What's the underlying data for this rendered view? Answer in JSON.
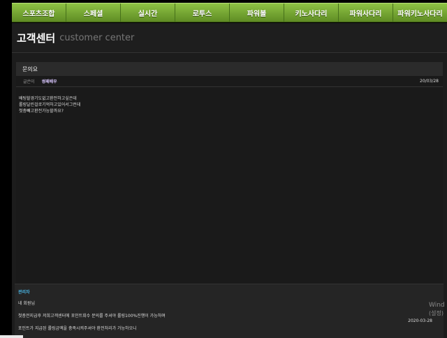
{
  "nav": {
    "items": [
      {
        "label": "스포츠조합"
      },
      {
        "label": "스페셜"
      },
      {
        "label": "실시간"
      },
      {
        "label": "로투스"
      },
      {
        "label": "파워볼"
      },
      {
        "label": "키노사다리"
      },
      {
        "label": "파워사다리"
      },
      {
        "label": "파워키노사다리"
      }
    ]
  },
  "header": {
    "title": "고객센터",
    "subtitle": "customer center"
  },
  "post": {
    "title": "문의요",
    "author_label": "글쓴이",
    "author": "썽패배우",
    "date": "20/03/28",
    "body_lines": [
      "배팅할경기도없고환전하고싶은데",
      "롤링달린걸로기억하고있어서그런데",
      "첫충빼고환전가능할까요?"
    ]
  },
  "reply": {
    "label": "관리자",
    "lines": [
      "네 회원님",
      "첫충전지급후 저희고객센터에 포인트회수 문의를 주셔야 롤링100%진행이 가능하며",
      "포인트가 지급된 롤링금액을 충족시켜주셔야 환전처리가 가능하오니"
    ],
    "date": "2020-03-28"
  },
  "watermark": {
    "line1": "Wind",
    "line2": "(설정)"
  }
}
